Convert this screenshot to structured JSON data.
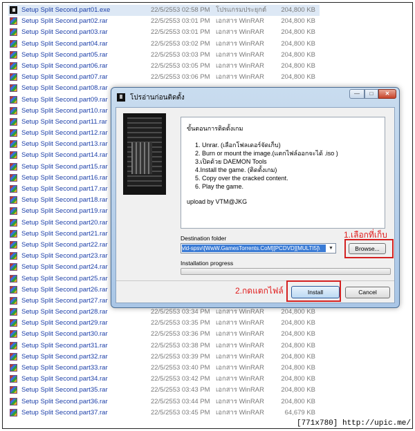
{
  "files": [
    {
      "name": "Setup Split Second.part01.exe",
      "date": "22/5/2553 02:58 PM",
      "type": "โปรแกรมประยุกต์",
      "size": "204,800 KB",
      "icon": "exe-icon"
    },
    {
      "name": "Setup Split Second.part02.rar",
      "date": "22/5/2553 03:01 PM",
      "type": "เอกสาร WinRAR",
      "size": "204,800 KB",
      "icon": "winrar-icon"
    },
    {
      "name": "Setup Split Second.part03.rar",
      "date": "22/5/2553 03:01 PM",
      "type": "เอกสาร WinRAR",
      "size": "204,800 KB",
      "icon": "winrar-icon"
    },
    {
      "name": "Setup Split Second.part04.rar",
      "date": "22/5/2553 03:02 PM",
      "type": "เอกสาร WinRAR",
      "size": "204,800 KB",
      "icon": "winrar-icon"
    },
    {
      "name": "Setup Split Second.part05.rar",
      "date": "22/5/2553 03:03 PM",
      "type": "เอกสาร WinRAR",
      "size": "204,800 KB",
      "icon": "winrar-icon"
    },
    {
      "name": "Setup Split Second.part06.rar",
      "date": "22/5/2553 03:05 PM",
      "type": "เอกสาร WinRAR",
      "size": "204,800 KB",
      "icon": "winrar-icon"
    },
    {
      "name": "Setup Split Second.part07.rar",
      "date": "22/5/2553 03:06 PM",
      "type": "เอกสาร WinRAR",
      "size": "204,800 KB",
      "icon": "winrar-icon"
    },
    {
      "name": "Setup Split Second.part08.rar",
      "date": "",
      "type": "",
      "size": "",
      "icon": "winrar-icon"
    },
    {
      "name": "Setup Split Second.part09.rar",
      "date": "",
      "type": "",
      "size": "",
      "icon": "winrar-icon"
    },
    {
      "name": "Setup Split Second.part10.rar",
      "date": "",
      "type": "",
      "size": "",
      "icon": "winrar-icon"
    },
    {
      "name": "Setup Split Second.part11.rar",
      "date": "",
      "type": "",
      "size": "",
      "icon": "winrar-icon"
    },
    {
      "name": "Setup Split Second.part12.rar",
      "date": "",
      "type": "",
      "size": "",
      "icon": "winrar-icon"
    },
    {
      "name": "Setup Split Second.part13.rar",
      "date": "",
      "type": "",
      "size": "",
      "icon": "winrar-icon"
    },
    {
      "name": "Setup Split Second.part14.rar",
      "date": "",
      "type": "",
      "size": "",
      "icon": "winrar-icon"
    },
    {
      "name": "Setup Split Second.part15.rar",
      "date": "",
      "type": "",
      "size": "",
      "icon": "winrar-icon"
    },
    {
      "name": "Setup Split Second.part16.rar",
      "date": "",
      "type": "",
      "size": "",
      "icon": "winrar-icon"
    },
    {
      "name": "Setup Split Second.part17.rar",
      "date": "",
      "type": "",
      "size": "",
      "icon": "winrar-icon"
    },
    {
      "name": "Setup Split Second.part18.rar",
      "date": "",
      "type": "",
      "size": "",
      "icon": "winrar-icon"
    },
    {
      "name": "Setup Split Second.part19.rar",
      "date": "",
      "type": "",
      "size": "",
      "icon": "winrar-icon"
    },
    {
      "name": "Setup Split Second.part20.rar",
      "date": "",
      "type": "",
      "size": "",
      "icon": "winrar-icon"
    },
    {
      "name": "Setup Split Second.part21.rar",
      "date": "",
      "type": "",
      "size": "",
      "icon": "winrar-icon"
    },
    {
      "name": "Setup Split Second.part22.rar",
      "date": "",
      "type": "",
      "size": "",
      "icon": "winrar-icon"
    },
    {
      "name": "Setup Split Second.part23.rar",
      "date": "",
      "type": "",
      "size": "",
      "icon": "winrar-icon"
    },
    {
      "name": "Setup Split Second.part24.rar",
      "date": "",
      "type": "",
      "size": "",
      "icon": "winrar-icon"
    },
    {
      "name": "Setup Split Second.part25.rar",
      "date": "",
      "type": "",
      "size": "",
      "icon": "winrar-icon"
    },
    {
      "name": "Setup Split Second.part26.rar",
      "date": "",
      "type": "",
      "size": "",
      "icon": "winrar-icon"
    },
    {
      "name": "Setup Split Second.part27.rar",
      "date": "",
      "type": "",
      "size": "",
      "icon": "winrar-icon"
    },
    {
      "name": "Setup Split Second.part28.rar",
      "date": "22/5/2553 03:34 PM",
      "type": "เอกสาร WinRAR",
      "size": "204,800 KB",
      "icon": "winrar-icon"
    },
    {
      "name": "Setup Split Second.part29.rar",
      "date": "22/5/2553 03:35 PM",
      "type": "เอกสาร WinRAR",
      "size": "204,800 KB",
      "icon": "winrar-icon"
    },
    {
      "name": "Setup Split Second.part30.rar",
      "date": "22/5/2553 03:36 PM",
      "type": "เอกสาร WinRAR",
      "size": "204,800 KB",
      "icon": "winrar-icon"
    },
    {
      "name": "Setup Split Second.part31.rar",
      "date": "22/5/2553 03:38 PM",
      "type": "เอกสาร WinRAR",
      "size": "204,800 KB",
      "icon": "winrar-icon"
    },
    {
      "name": "Setup Split Second.part32.rar",
      "date": "22/5/2553 03:39 PM",
      "type": "เอกสาร WinRAR",
      "size": "204,800 KB",
      "icon": "winrar-icon"
    },
    {
      "name": "Setup Split Second.part33.rar",
      "date": "22/5/2553 03:40 PM",
      "type": "เอกสาร WinRAR",
      "size": "204,800 KB",
      "icon": "winrar-icon"
    },
    {
      "name": "Setup Split Second.part34.rar",
      "date": "22/5/2553 03:42 PM",
      "type": "เอกสาร WinRAR",
      "size": "204,800 KB",
      "icon": "winrar-icon"
    },
    {
      "name": "Setup Split Second.part35.rar",
      "date": "22/5/2553 03:43 PM",
      "type": "เอกสาร WinRAR",
      "size": "204,800 KB",
      "icon": "winrar-icon"
    },
    {
      "name": "Setup Split Second.part36.rar",
      "date": "22/5/2553 03:44 PM",
      "type": "เอกสาร WinRAR",
      "size": "204,800 KB",
      "icon": "winrar-icon"
    },
    {
      "name": "Setup Split Second.part37.rar",
      "date": "22/5/2553 03:45 PM",
      "type": "เอกสาร WinRAR",
      "size": "64,679 KB",
      "icon": "winrar-icon"
    }
  ],
  "dialog": {
    "title": "โปรอ่านก่อนติดตั้ง",
    "window_controls": {
      "minimize": "—",
      "maximize": "□",
      "close": "✕"
    },
    "info": {
      "heading": "ขั้นตอนการติดตั้งเกม",
      "steps": [
        "1. Unrar. (เลือกโฟลเดอร์จัดเก็บ)",
        "2. Burn or mount the image.(แตกไฟล์ออกจะได้ .iso )",
        "3.เปิดด้วย DAEMON Tools",
        "4.Install the game. (ติดตั้งเกม)",
        "5. Copy over the cracked content.",
        "6. Play the game."
      ],
      "footer": "upload by VTM@JKG"
    },
    "destination_label": "Destination folder",
    "destination_value": "\\[MULTI5][PCDVD][WwW.GamesTorrents.CoM]\\vld-spsv",
    "browse_label": "Browse...",
    "progress_label": "Installation progress",
    "progress_value": 0,
    "install_label": "Install",
    "cancel_label": "Cancel"
  },
  "annotations": {
    "browse": "1.เลือกที่เก็บ",
    "install": "2.กดแตกไฟล์"
  },
  "highlight_color": "#d31f1f",
  "watermark": "[771x780] http://upic.me/"
}
